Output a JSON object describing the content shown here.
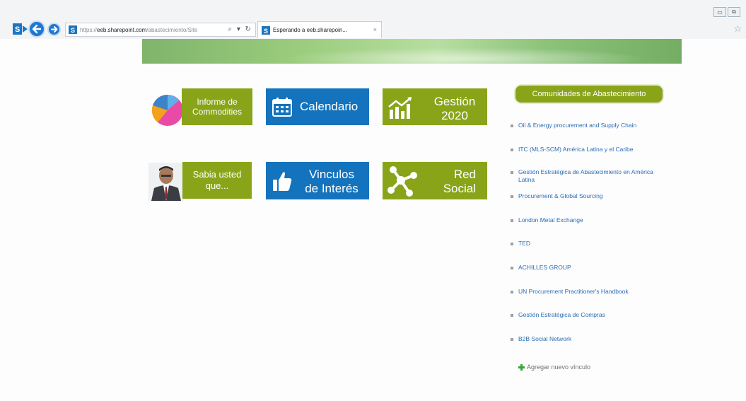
{
  "browser": {
    "address": {
      "prefix": "https://",
      "domain": "eeb.sharepoint.com",
      "path": "/abastecimiento/Site",
      "actions": "⌕ ▾ ↻"
    },
    "tab": {
      "title": "Esperando a eeb.sharepoin...",
      "close": "×"
    },
    "window_buttons": [
      "▭",
      "⧉"
    ]
  },
  "tiles": {
    "commodities": "Informe de\nCommodities",
    "calendario": "Calendario",
    "gestion": "Gestión\n2020",
    "sabia": "Sabia usted\nque...",
    "vinculos": "Vinculos\nde Interés",
    "red": "Red\nSocial"
  },
  "communities": {
    "header": "Comunidades de Abastecimiento",
    "items": [
      "Oil & Energy procurement and Supply Chain",
      "ITC (MLS-SCM) América Latina y el Caribe",
      "Gestión Estratégica de Abastecimiento en América Latina",
      "Procurement & Global Sourcing",
      "London Metal Exchange",
      "TED",
      "ACHILLES GROUP",
      "UN Procurement Practitioner's Handbook",
      "Gestión Estratégica de Compras",
      "B2B Social Network"
    ],
    "add_link": "Agregar nuevo vínculo"
  },
  "colors": {
    "tile_green": "#8aa419",
    "tile_blue": "#1473bd",
    "link_blue": "#2a6db5"
  }
}
